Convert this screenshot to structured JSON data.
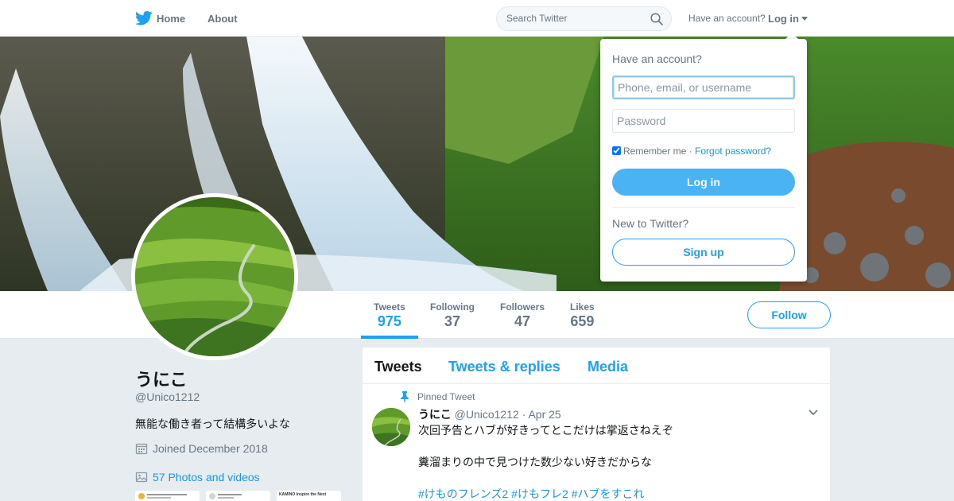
{
  "nav": {
    "home": "Home",
    "about": "About",
    "search_placeholder": "Search Twitter",
    "have_account": "Have an account?",
    "login": "Log in"
  },
  "colors": {
    "accent": "#1da1f2",
    "login_button": "#4ab3f4",
    "link": "#1b95e0"
  },
  "icons": [
    "twitter-bird-icon",
    "search-icon",
    "caret-down-icon",
    "calendar-icon",
    "photo-icon",
    "pin-icon",
    "chevron-down-icon"
  ],
  "stats": [
    {
      "label": "Tweets",
      "value": "975"
    },
    {
      "label": "Following",
      "value": "37"
    },
    {
      "label": "Followers",
      "value": "47"
    },
    {
      "label": "Likes",
      "value": "659"
    }
  ],
  "follow": "Follow",
  "profile": {
    "name": "うにこ",
    "handle": "@Unico1212",
    "bio": "無能な働き者って結構多いよな",
    "joined": "Joined December 2018",
    "photos": "57 Photos and videos",
    "thumb3": "KAMINO Inspire the Next"
  },
  "tabs": [
    "Tweets",
    "Tweets & replies",
    "Media"
  ],
  "tweet": {
    "pinned": "Pinned Tweet",
    "name": "うにこ",
    "handle": "@Unico1212",
    "date": "· Apr 25",
    "line1": "次回予告とハブが好きってとこだけは掌返さねえぞ",
    "line2": "糞溜まりの中で見つけた数少ない好きだからな",
    "tags": "#けものフレンズ2 #けもフレ2 #ハブをすこれ"
  },
  "login_dropdown": {
    "title": "Have an account?",
    "username_placeholder": "Phone, email, or username",
    "password_placeholder": "Password",
    "remember": "Remember me",
    "separator": " · ",
    "forgot": "Forgot password?",
    "login": "Log in",
    "new_to": "New to Twitter?",
    "signup": "Sign up"
  }
}
